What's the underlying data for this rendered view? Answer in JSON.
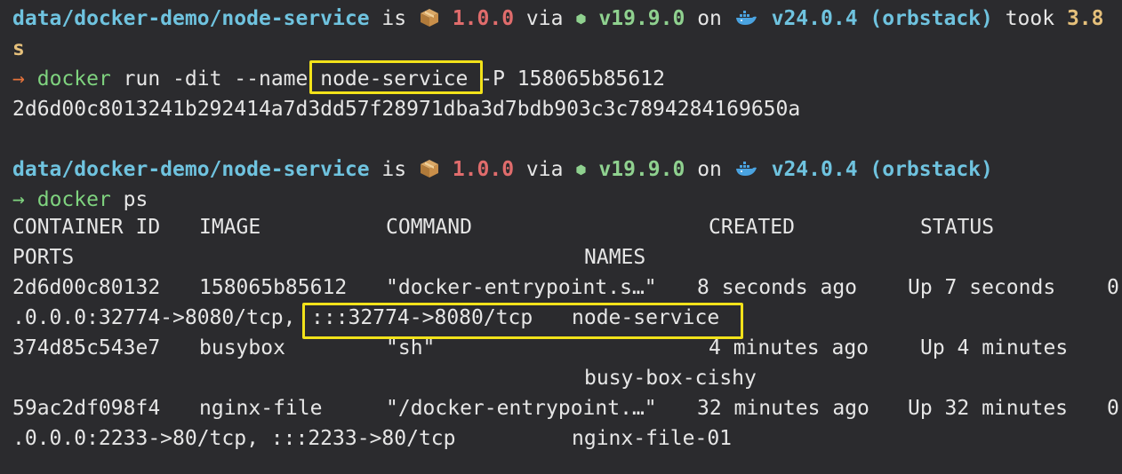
{
  "prompt1": {
    "path": "data/docker-demo/node-service",
    "is": " is ",
    "pkg_version": "1.0.0",
    "via": " via ",
    "node_version": "v19.9.0",
    "on": " on ",
    "docker_version": "v24.0.4 (orbstack)",
    "took_label": " took ",
    "took_value": "3.8",
    "took_wrap": "s"
  },
  "cmd1": {
    "arrow": "→",
    "program": "docker",
    "args_before": " run -dit --name ",
    "name_arg": "node-service",
    "args_after": " -P 158065b85612",
    "output": "2d6d00c8013241b292414a7d3dd57f28971dba3d7bdb903c3c7894284169650a"
  },
  "prompt2": {
    "path": "data/docker-demo/node-service",
    "is": " is ",
    "pkg_version": "1.0.0",
    "via": " via ",
    "node_version": "v19.9.0",
    "on": " on ",
    "docker_version": "v24.0.4 (orbstack)"
  },
  "cmd2": {
    "arrow": "→",
    "program": "docker",
    "args": " ps"
  },
  "ps_table": {
    "headers": {
      "container_id": "CONTAINER ID",
      "image": "IMAGE",
      "command": "COMMAND",
      "created": "CREATED",
      "status": "STATUS",
      "ports": "PORTS",
      "names": "NAMES"
    },
    "rows": [
      {
        "container_id": "2d6d00c80132",
        "image": "158065b85612",
        "command": "\"docker-entrypoint.s…\"",
        "created": "8 seconds ago",
        "status": "Up 7 seconds",
        "wrap_char": "0",
        "ports_a": ".0.0.0:32774->8080/tcp,",
        "ports_b": ":::32774->8080/tcp",
        "names": "node-service"
      },
      {
        "container_id": "374d85c543e7",
        "image": "busybox",
        "command": "\"sh\"",
        "created": "4 minutes ago",
        "status": "Up 4 minutes",
        "names": "busy-box-cishy"
      },
      {
        "container_id": "59ac2df098f4",
        "image": "nginx-file",
        "command": "\"/docker-entrypoint.…\"",
        "created": "32 minutes ago",
        "status": "Up 32 minutes",
        "wrap_char": "0",
        "ports": ".0.0.0:2233->80/tcp, :::2233->80/tcp",
        "names": "nginx-file-01"
      }
    ]
  },
  "colors": {
    "background": "#2b2b2e",
    "path": "#6fc3df",
    "version": "#e06c6c",
    "node": "#8fd18f",
    "highlight": "#f2e21a"
  }
}
